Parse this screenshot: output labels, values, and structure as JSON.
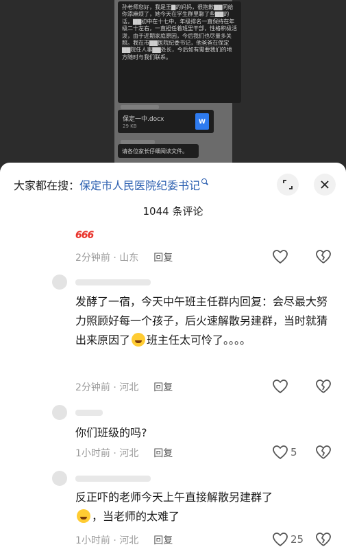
{
  "background": {
    "chat_message": "孙老师您好，我是王▇的妈妈，很抱歉▇▇同给你添麻烦了，她今天在学生群里聊了些▇▇的话，▇▇初中在十七中，年级排名一直保持在年级二十左右，一直担任着班里干部，性格积极活泼，由于近期家庭原因，今后我们也尽量多关照。我在市▇▇医院纪委书记，他爸爸在保定▇▇院任人事▇▇处长，今后如有需要我们的地方随时与我们联系。",
    "file_name": "保定一中.docx",
    "file_size": "29 KB",
    "file_icon": "W",
    "small_msg": "请各位家长仔细阅读文件。"
  },
  "sheet": {
    "search_prefix": "大家都在搜：",
    "search_term": "保定市人民医院纪委书记",
    "comment_count": "1044 条评论",
    "comments": [
      {
        "text": "666",
        "time": "2分钟前 · 山东",
        "reply": "回复",
        "likes": ""
      },
      {
        "text": "发酵了一宿，今天中午班主任群内回复：会尽最大努力照顾好每一个孩子，后火速解散另建群，当时就猜出来原因了",
        "text_tail": "班主任太可怜了。。。。",
        "time": "2分钟前 · 河北",
        "reply": "回复",
        "likes": ""
      },
      {
        "text": "你们班级的吗?",
        "time": "1小时前 · 河北",
        "reply": "回复",
        "likes": "5"
      },
      {
        "text": "反正吓的老师今天上午直接解散另建群了",
        "text_tail": "，当老师的太难了",
        "time": "1小时前 · 河北",
        "reply": "回复",
        "likes": "25"
      }
    ]
  },
  "colors": {
    "search_term": "#2b5fb0",
    "emoji_red": "#e8342c",
    "meta": "#9a9a9a"
  }
}
